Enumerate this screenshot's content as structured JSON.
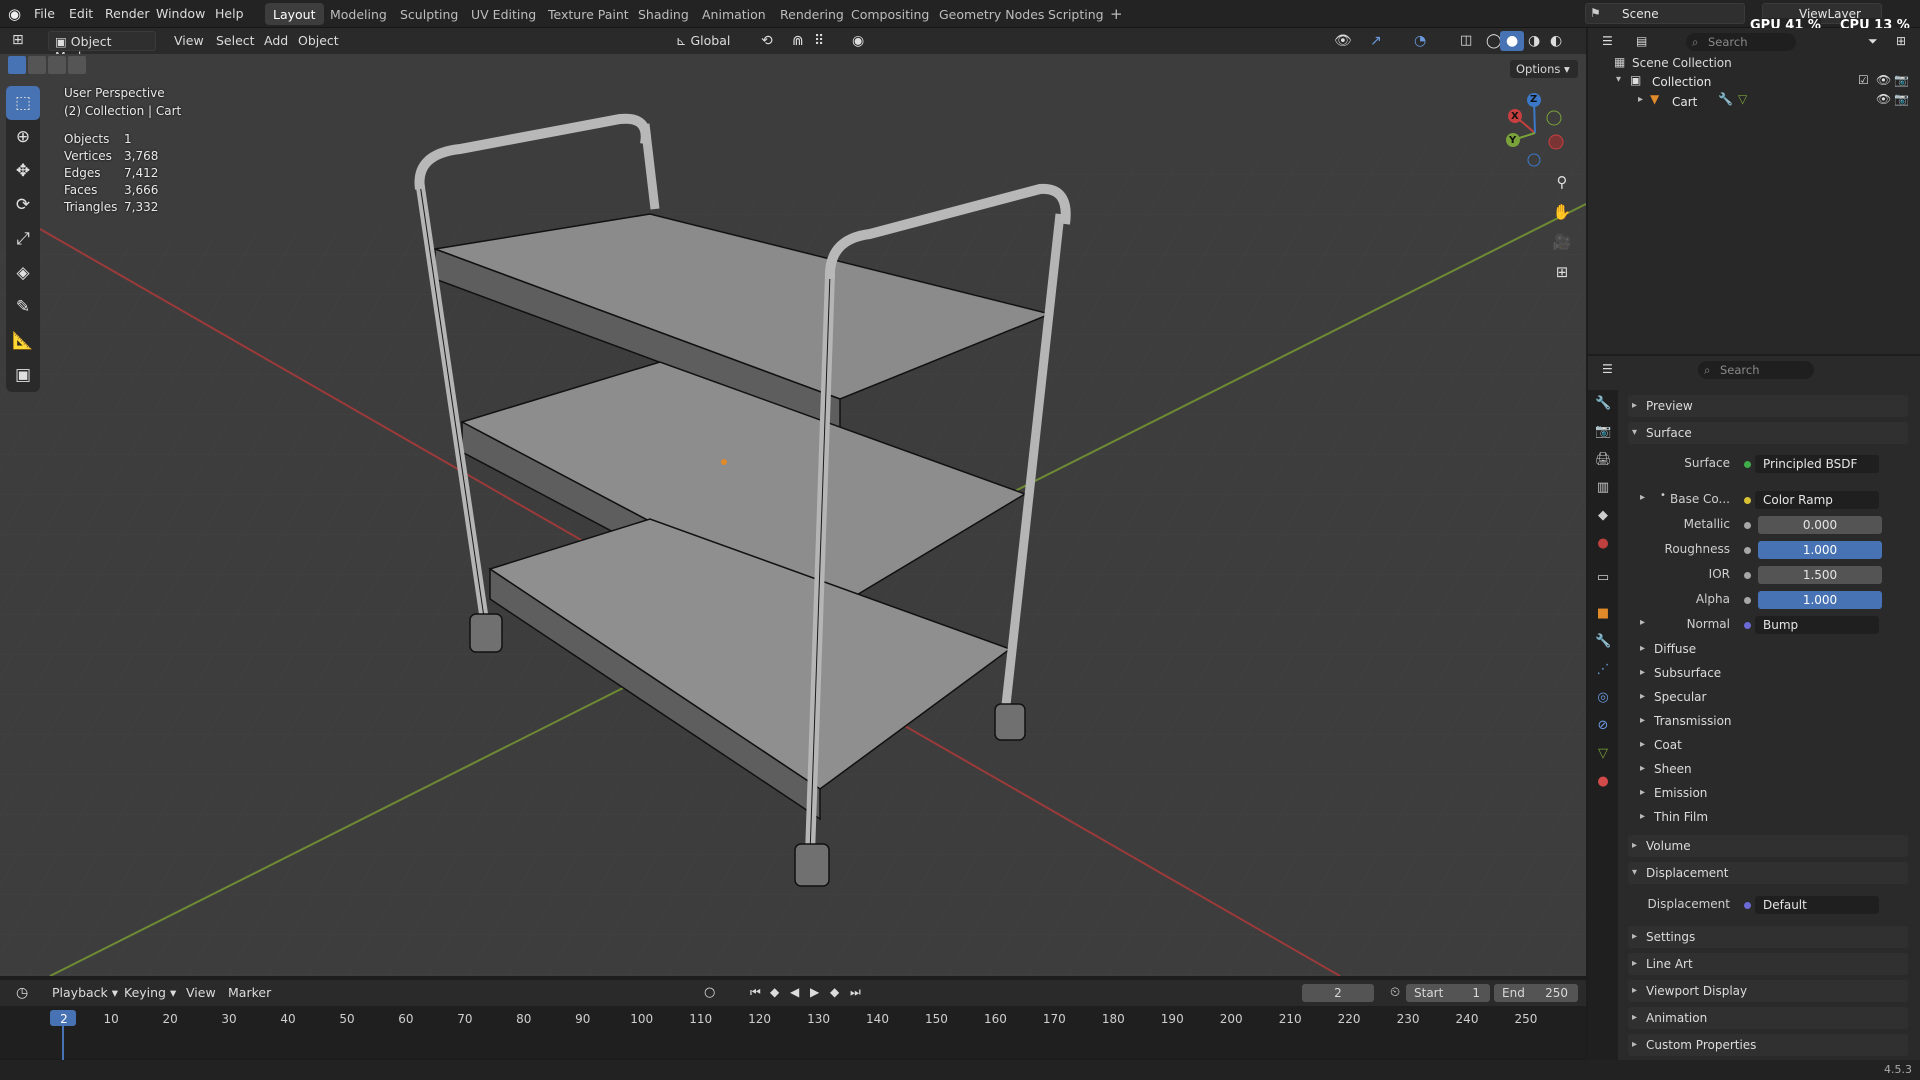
{
  "menus": [
    "File",
    "Edit",
    "Render",
    "Window",
    "Help"
  ],
  "workspaces": [
    "Layout",
    "Modeling",
    "Sculpting",
    "UV Editing",
    "Texture Paint",
    "Shading",
    "Animation",
    "Rendering",
    "Compositing",
    "Geometry Nodes",
    "Scripting"
  ],
  "scene": {
    "label": "Scene",
    "view_layer": "ViewLayer",
    "gpu": "GPU 41 %",
    "cpu": "CPU 13 %"
  },
  "viewport_header": {
    "mode": "Object Mode",
    "view": "View",
    "select": "Select",
    "add": "Add",
    "object": "Object",
    "transform": "Global",
    "options": "Options"
  },
  "overlay": {
    "perspective": "User Perspective",
    "collection": "(2) Collection | Cart"
  },
  "stats": [
    {
      "label": "Objects",
      "value": "1"
    },
    {
      "label": "Vertices",
      "value": "3,768"
    },
    {
      "label": "Edges",
      "value": "7,412"
    },
    {
      "label": "Faces",
      "value": "3,666"
    },
    {
      "label": "Triangles",
      "value": "7,332"
    }
  ],
  "gizmo": {
    "x": "X",
    "y": "Y",
    "z": "Z"
  },
  "outliner": {
    "search": "Search",
    "scene_collection": "Scene Collection",
    "collection": "Collection",
    "object": "Cart"
  },
  "properties": {
    "search": "Search",
    "preview": "Preview",
    "surface_section": "Surface",
    "surface_label": "Surface",
    "surface_value": "Principled BSDF",
    "base_color_label": "Base Co...",
    "base_color_value": "Color Ramp",
    "metallic_label": "Metallic",
    "metallic_value": "0.000",
    "roughness_label": "Roughness",
    "roughness_value": "1.000",
    "ior_label": "IOR",
    "ior_value": "1.500",
    "alpha_label": "Alpha",
    "alpha_value": "1.000",
    "normal_label": "Normal",
    "normal_value": "Bump",
    "subpanels": [
      "Diffuse",
      "Subsurface",
      "Specular",
      "Transmission",
      "Coat",
      "Sheen",
      "Emission",
      "Thin Film"
    ],
    "volume": "Volume",
    "displacement_section": "Displacement",
    "displacement_label": "Displacement",
    "displacement_value": "Default",
    "sections_after": [
      "Settings",
      "Line Art",
      "Viewport Display",
      "Animation",
      "Custom Properties"
    ]
  },
  "timeline": {
    "playback": "Playback",
    "keying": "Keying",
    "view": "View",
    "marker": "Marker",
    "current_frame": "2",
    "start_label": "Start",
    "start": "1",
    "end_label": "End",
    "end": "250",
    "ticks": [
      "2",
      "10",
      "20",
      "30",
      "40",
      "50",
      "60",
      "70",
      "80",
      "90",
      "100",
      "110",
      "120",
      "130",
      "140",
      "150",
      "160",
      "170",
      "180",
      "190",
      "200",
      "210",
      "220",
      "230",
      "240",
      "250"
    ]
  },
  "version": "4.5.3",
  "colors": {
    "accent": "#4772b3",
    "x_axis": "#c83f3f",
    "y_axis": "#7aa23a",
    "z_axis": "#3b78c8"
  }
}
